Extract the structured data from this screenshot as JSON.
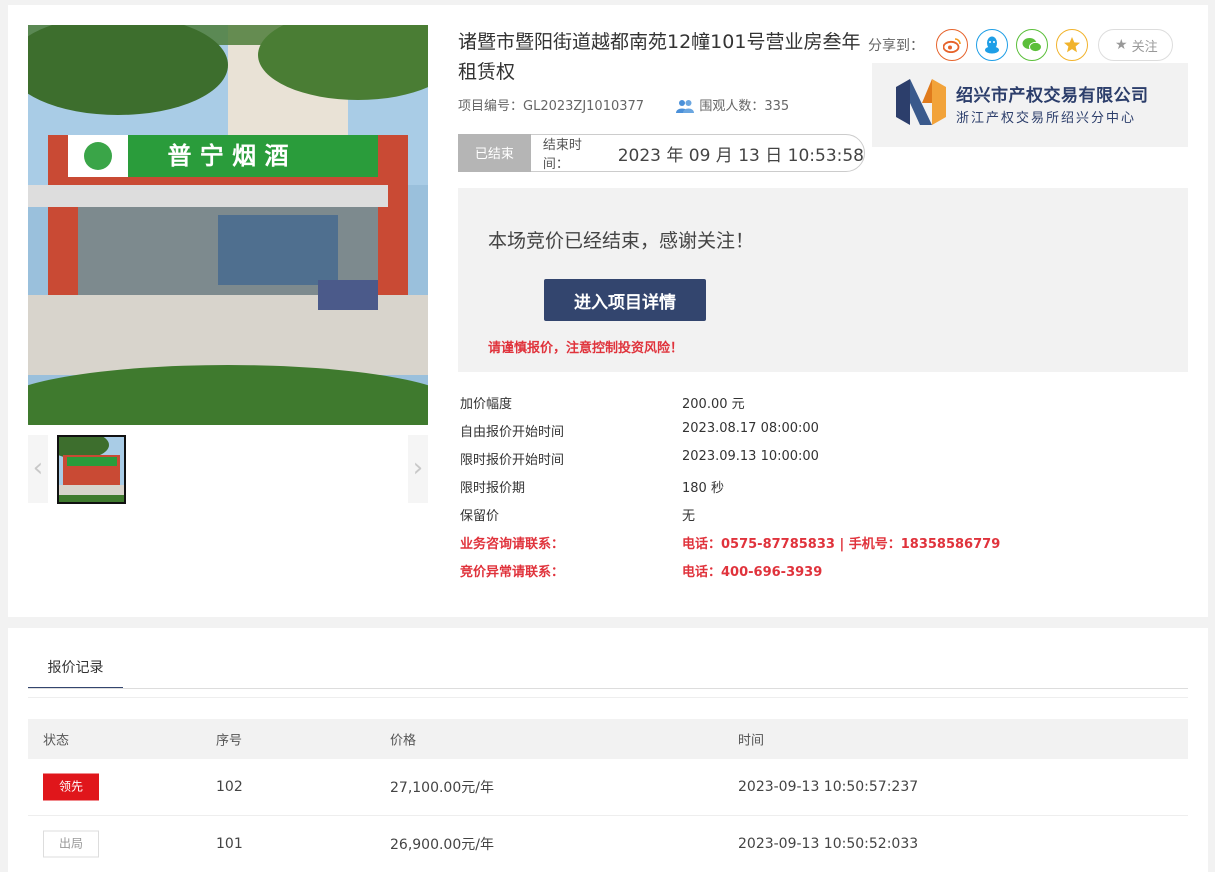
{
  "project": {
    "title": "诸暨市暨阳街道越都南苑12幢101号营业房叁年租赁权",
    "code_label": "项目编号：",
    "code": "GL2023ZJ1010377",
    "viewers_label": "围观人数：",
    "viewers": "335"
  },
  "share": {
    "label": "分享到：",
    "icons": [
      "weibo-icon",
      "qq-icon",
      "wechat-icon",
      "qzone-icon"
    ],
    "follow_label": "关注"
  },
  "org": {
    "name": "绍兴市产权交易有限公司",
    "sub": "浙江产权交易所绍兴分中心"
  },
  "status": {
    "badge": "已结束",
    "end_label": "结束时间：",
    "end_time": "2023 年  09 月  13 日  10:53:58"
  },
  "notice": {
    "message": "本场竞价已经结束，感谢关注！",
    "button": "进入项目详情",
    "warning": "请谨慎报价，注意控制投资风险！"
  },
  "photo": {
    "sign_text": "普 宁 烟 酒"
  },
  "info": [
    {
      "k": "加价幅度",
      "v": "200.00 元"
    },
    {
      "k": "自由报价开始时间",
      "v": "2023.08.17 08:00:00"
    },
    {
      "k": "限时报价开始时间",
      "v": "2023.09.13 10:00:00"
    },
    {
      "k": "限时报价期",
      "v": "180 秒"
    },
    {
      "k": "保留价",
      "v": "无"
    },
    {
      "k": "业务咨询请联系：",
      "v": "电话：0575-87785833 | 手机号：18358586779"
    },
    {
      "k": "竞价异常请联系：",
      "v": "电话：400-696-3939"
    }
  ],
  "tabs": {
    "bid_record": "报价记录"
  },
  "bid_table": {
    "headers": [
      "状态",
      "序号",
      "价格",
      "时间"
    ],
    "rows": [
      {
        "status": "领先",
        "no": "102",
        "price": "27,100.00元/年",
        "time": "2023-09-13 10:50:57:237"
      },
      {
        "status": "出局",
        "no": "101",
        "price": "26,900.00元/年",
        "time": "2023-09-13 10:50:52:033"
      }
    ]
  },
  "colors": {
    "accent": "#33456e",
    "warning_red": "#e0333c",
    "lead_red": "#e0161b"
  }
}
